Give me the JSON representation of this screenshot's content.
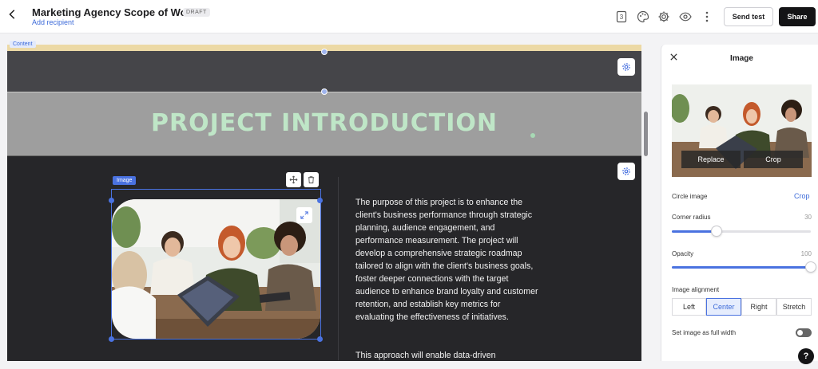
{
  "header": {
    "back_icon": "chevron-left-icon",
    "title": "Marketing Agency Scope of Work",
    "status_badge": "DRAFT",
    "add_recipient": "Add recipient",
    "page_count": "3",
    "send_test": "Send test",
    "share": "Share"
  },
  "canvas": {
    "content_tag": "Content",
    "heading": "PROJECT INTRODUCTION",
    "image_tag": "Image",
    "paragraph": "The purpose of this project is to enhance the client's business performance through strategic planning, audience engagement, and performance measurement. The project will develop a comprehensive strategic roadmap tailored to align with the client's business goals, foster deeper connections with the target audience to enhance brand loyalty and customer retention, and establish key metrics for evaluating the effectiveness of initiatives.",
    "paragraph2": "This approach will enable data-driven"
  },
  "panel": {
    "title": "Image",
    "replace": "Replace",
    "crop": "Crop",
    "circle_image": "Circle image",
    "circle_crop": "Crop",
    "corner_radius_label": "Corner radius",
    "corner_radius_value": "30",
    "corner_radius_fraction": 0.32,
    "opacity_label": "Opacity",
    "opacity_value": "100",
    "opacity_fraction": 1.0,
    "alignment_label": "Image alignment",
    "alignment_options": [
      "Left",
      "Center",
      "Right",
      "Stretch"
    ],
    "alignment_selected": "Center",
    "full_width_label": "Set image as full width",
    "full_width_on": false
  },
  "help": "?",
  "colors": {
    "accent": "#4a72e0",
    "heading": "#bfe6c7",
    "dark_section": "#262629",
    "gray_section": "#9e9e9e"
  }
}
